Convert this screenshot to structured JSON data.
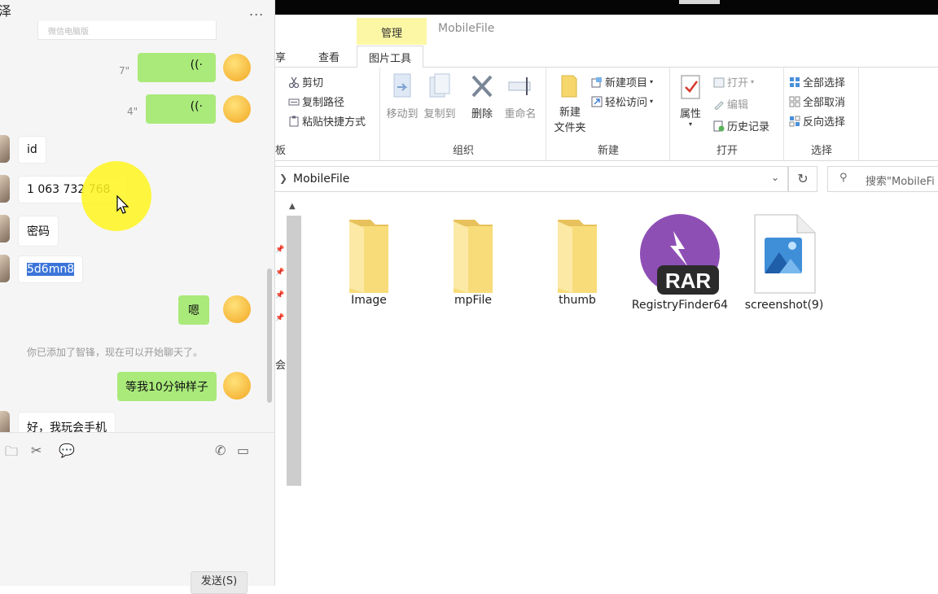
{
  "chat": {
    "contact_name": "泽",
    "more_label": "...",
    "top_card_text": "微信电脑版",
    "messages": [
      {
        "duration": "7\""
      },
      {
        "duration": "4\""
      },
      {
        "text": "id"
      },
      {
        "text_a": "1 063 732 ",
        "text_b": "768"
      },
      {
        "text": "密码"
      },
      {
        "text": "5d6mn8"
      },
      {
        "text": "嗯"
      },
      {
        "system": "你已添加了智锋，现在可以开始聊天了。"
      },
      {
        "text": "等我10分钟样子"
      },
      {
        "text": "好，我玩会手机"
      }
    ],
    "send_label": "发送(S)"
  },
  "explorer": {
    "window_title": "MobileFile",
    "context_tab": "管理",
    "tabs": [
      "享",
      "查看",
      "图片工具"
    ],
    "ribbon": {
      "clipboard": {
        "group_label": "板",
        "cut": "剪切",
        "copy_path": "复制路径",
        "paste_shortcut": "粘贴快捷方式"
      },
      "organize": {
        "group_label": "组织",
        "move_to": "移动到",
        "copy_to": "复制到",
        "delete": "删除",
        "rename": "重命名"
      },
      "new": {
        "group_label": "新建",
        "new_folder_1": "新建",
        "new_folder_2": "文件夹",
        "new_item": "新建项目",
        "easy_access": "轻松访问"
      },
      "open": {
        "group_label": "打开",
        "properties": "属性",
        "open": "打开",
        "edit": "编辑",
        "history": "历史记录"
      },
      "select": {
        "group_label": "选择",
        "select_all": "全部选择",
        "select_none": "全部取消",
        "invert": "反向选择"
      }
    },
    "address": {
      "crumb": "MobileFile"
    },
    "search_placeholder": "搜索\"MobileFi",
    "files": [
      {
        "name": "Image",
        "icon": "folder-icon"
      },
      {
        "name": "mpFile",
        "icon": "folder-icon"
      },
      {
        "name": "thumb",
        "icon": "folder-icon"
      },
      {
        "name": "RegistryFinder64",
        "icon": "rar-archive-icon"
      },
      {
        "name": "screenshot(9)",
        "icon": "image-file-icon"
      }
    ],
    "nav_fragment": "会"
  },
  "colors": {
    "chat_bubble_me": "#a9ea7a",
    "context_tab": "#fcf7a4",
    "rar_purple": "#8e4fb5",
    "cursor_halo": "#fff51e"
  }
}
